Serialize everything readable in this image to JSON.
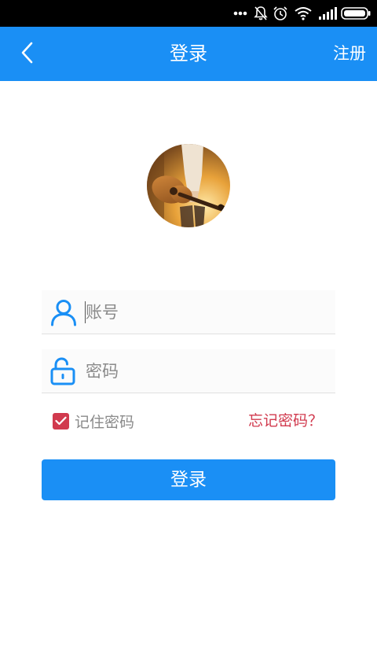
{
  "status_bar": {
    "icons": [
      "more-dots-icon",
      "notifications-off-icon",
      "alarm-icon",
      "wifi-icon",
      "signal-icon",
      "battery-icon"
    ]
  },
  "title_bar": {
    "back_icon": "chevron-left-icon",
    "title": "登录",
    "register_label": "注册"
  },
  "avatar": {
    "description_icon": "avatar-photo"
  },
  "form": {
    "account_placeholder": "账号",
    "account_value": "",
    "account_icon": "user-icon",
    "password_placeholder": "密码",
    "password_value": "",
    "password_icon": "unlock-icon"
  },
  "options": {
    "remember_label": "记住密码",
    "remember_checked": true,
    "forgot_label": "忘记密码？"
  },
  "login_button_label": "登录",
  "colors": {
    "primary": "#1a8ff5",
    "accent": "#d13a4e",
    "placeholder": "#8a8a8a"
  }
}
